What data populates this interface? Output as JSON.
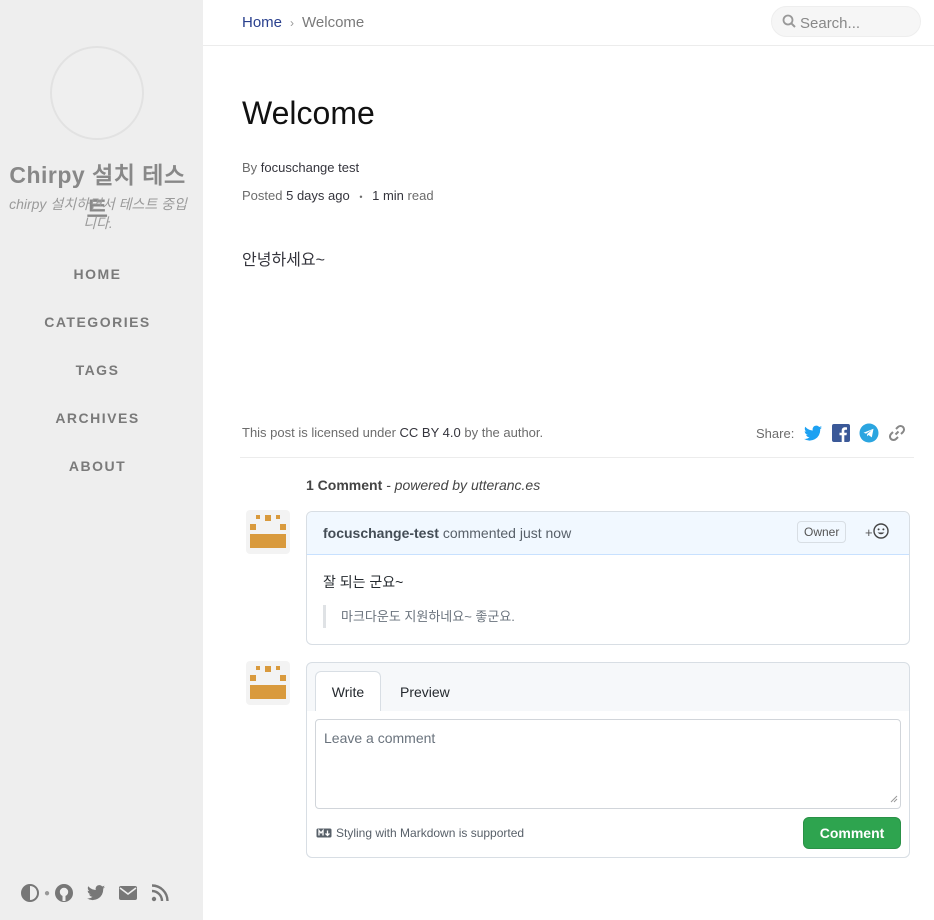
{
  "sidebar": {
    "title": "Chirpy 설치 테스트",
    "subtitle": "chirpy 설치하면서 테스트 중입니다.",
    "nav": [
      {
        "label": "HOME",
        "icon": "home-icon"
      },
      {
        "label": "CATEGORIES",
        "icon": "categories-icon"
      },
      {
        "label": "TAGS",
        "icon": "tags-icon"
      },
      {
        "label": "ARCHIVES",
        "icon": "archives-icon"
      },
      {
        "label": "ABOUT",
        "icon": "about-icon"
      }
    ],
    "bottom_icons": [
      "theme-toggle-icon",
      "github-icon",
      "twitter-icon",
      "email-icon",
      "rss-icon"
    ]
  },
  "topbar": {
    "breadcrumb_home": "Home",
    "breadcrumb_separator": "›",
    "breadcrumb_current": "Welcome",
    "search_placeholder": "Search..."
  },
  "post": {
    "title": "Welcome",
    "by_label": "By",
    "author": "focuschange test",
    "posted_label": "Posted",
    "posted_time": "5 days ago",
    "separator": "•",
    "read_time": "1 min",
    "read_label": "read",
    "content": "안녕하세요~"
  },
  "footer": {
    "license_prefix": "This post is licensed under",
    "license_name": "CC BY 4.0",
    "license_suffix": "by the author.",
    "share_label": "Share:",
    "share_icons": [
      "twitter-icon",
      "facebook-icon",
      "telegram-icon",
      "link-icon"
    ]
  },
  "comments": {
    "count_label": "1 Comment",
    "powered_by": "- powered by utteranc.es",
    "items": [
      {
        "author": "focuschange-test",
        "action": "commented just now",
        "badge": "Owner",
        "reaction_label": "+",
        "body": "잘 되는 군요~",
        "quote": "마크다운도 지원하네요~ 좋군요."
      }
    ],
    "editor": {
      "tab_write": "Write",
      "tab_preview": "Preview",
      "placeholder": "Leave a comment",
      "markdown_note": "Styling with Markdown is supported",
      "submit_label": "Comment"
    }
  },
  "colors": {
    "sidebar_bg": "#eeeeee",
    "link": "#2a408e",
    "share_blue": "#1da1f2",
    "comment_button": "#2ea44f",
    "comment_header_bg": "#f1f8ff"
  }
}
